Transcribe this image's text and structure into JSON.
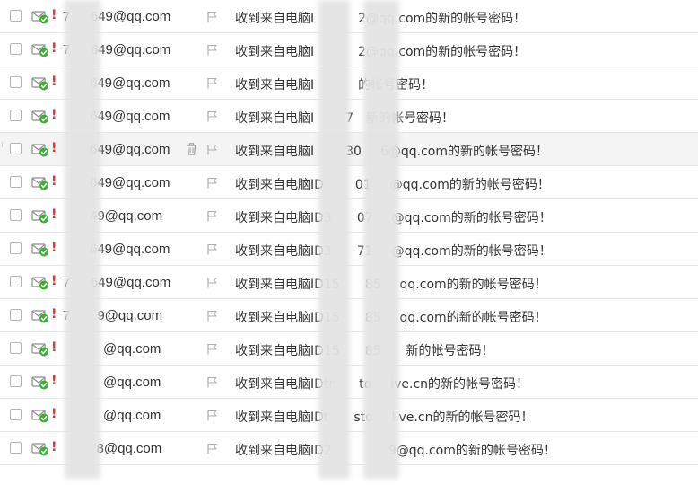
{
  "mail_list": {
    "colors": {
      "priority": "#e8322a",
      "check_badge": "#3cb034",
      "envelope": "#8d8d8d",
      "text": "#333333"
    },
    "icons": {
      "read_status": "envelope-check-icon",
      "priority": "exclamation-icon",
      "flag": "flag-icon",
      "delete": "trash-icon"
    },
    "rows": [
      {
        "priority": "!",
        "sender": "7   649@qq.com",
        "subject": "收到来自电脑I       2@qq.com的新的帐号密码！"
      },
      {
        "priority": "!",
        "sender": "7   649@qq.com",
        "subject": "收到来自电脑I       2@qq.com的新的帐号密码！"
      },
      {
        "priority": "!",
        "sender": "    649@qq.com",
        "subject": "收到来自电脑I       的帐号密码！"
      },
      {
        "priority": "!",
        "sender": "    649@qq.com",
        "subject": "收到来自电脑I     7  新的帐号密码！"
      },
      {
        "priority": "!",
        "sender": "    649@qq.com",
        "subject": "收到来自电脑I     30   6@qq.com的新的帐号密码！"
      },
      {
        "priority": "!",
        "sender": "    649@qq.com",
        "subject": "收到来自电脑ID     01   @qq.com的新的帐号密码！"
      },
      {
        "priority": "!",
        "sender": "    49@qq.com",
        "subject": "收到来自电脑ID3    07   @qq.com的新的帐号密码！"
      },
      {
        "priority": "!",
        "sender": "    649@qq.com",
        "subject": "收到来自电脑ID3    71   @qq.com的新的帐号密码！"
      },
      {
        "priority": "!",
        "sender": "7   649@qq.com",
        "subject": "收到来自电脑ID15    85   qq.com的新的帐号密码！"
      },
      {
        "priority": "!",
        "sender": "7    9@qq.com",
        "subject": "收到来自电脑ID15    85   qq.com的新的帐号密码！"
      },
      {
        "priority": "!",
        "sender": "      @qq.com",
        "subject": "收到来自电脑ID15    85    新的帐号密码！"
      },
      {
        "priority": "!",
        "sender": "      @qq.com",
        "subject": "收到来自电脑IDtr    to   ive.cn的新的帐号密码！"
      },
      {
        "priority": "!",
        "sender": "      @qq.com",
        "subject": "收到来自电脑IDt    sto   live.cn的新的帐号密码！"
      },
      {
        "priority": "!",
        "sender": "     8@qq.com",
        "subject": "收到来自电脑ID2         9@qq.com的新的帐号密码！"
      }
    ]
  }
}
